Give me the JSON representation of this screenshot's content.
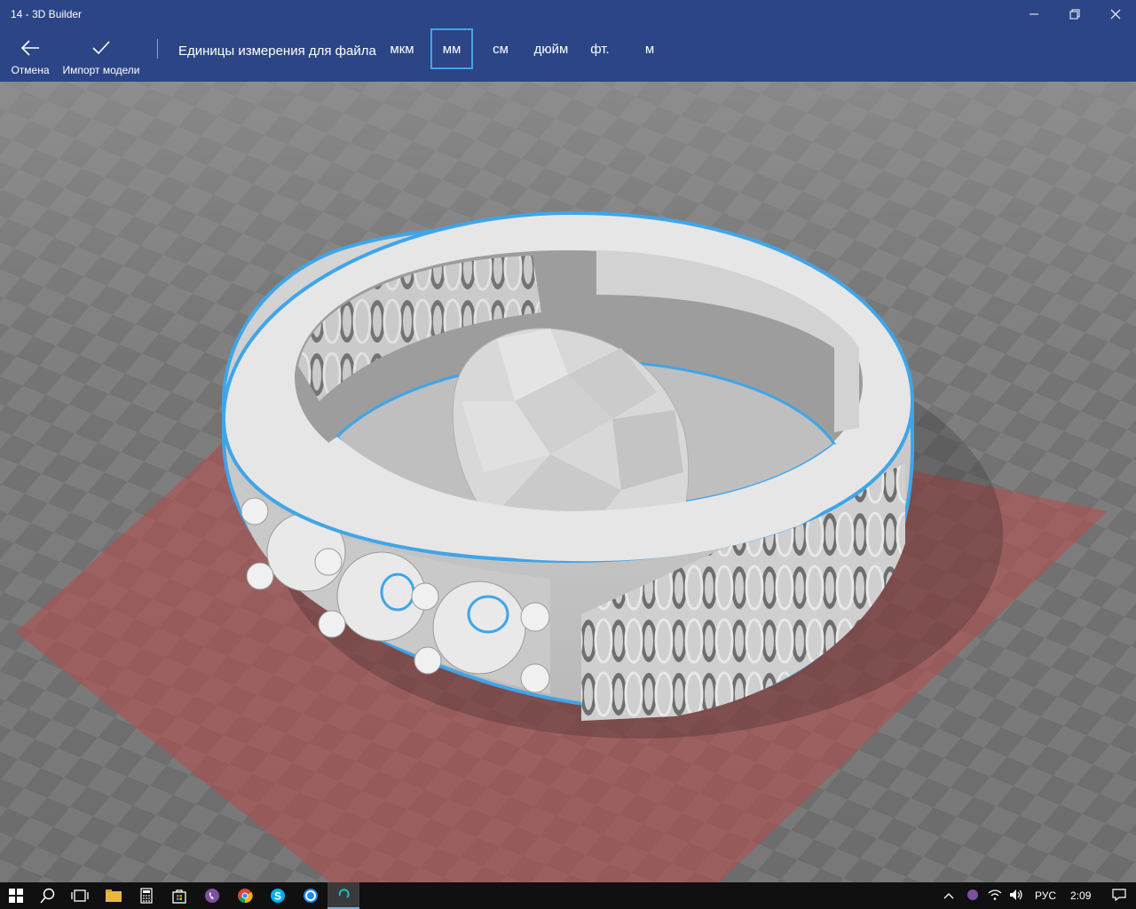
{
  "window": {
    "title": "14 - 3D Builder"
  },
  "toolbar": {
    "cancel_label": "Отмена",
    "import_label": "Импорт модели",
    "units_label": "Единицы измерения для файла",
    "units": [
      {
        "label": "мкм",
        "selected": false
      },
      {
        "label": "мм",
        "selected": true
      },
      {
        "label": "см",
        "selected": false
      },
      {
        "label": "дюйм",
        "selected": false
      },
      {
        "label": "фт.",
        "selected": false
      },
      {
        "label": "м",
        "selected": false
      }
    ]
  },
  "colors": {
    "accent": "#2b4586",
    "selection_outline": "#3fa5e8",
    "print_bed": "#b84a4a",
    "model": "#e6e6e6"
  },
  "taskbar": {
    "apps": [
      "start-icon",
      "search-icon",
      "task-view-icon",
      "file-explorer-icon",
      "calculator-icon",
      "store-icon",
      "viber-icon",
      "chrome-icon",
      "skype-icon",
      "browser-icon",
      "3d-builder-icon"
    ],
    "language": "РУС",
    "time": "2:09"
  }
}
